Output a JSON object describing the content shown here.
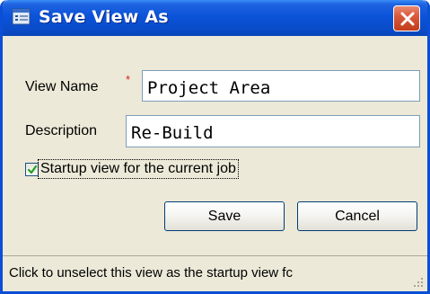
{
  "dialog": {
    "title": "Save View As",
    "close_icon": "close-icon"
  },
  "form": {
    "view_name_label": "View Name",
    "required_marker": "*",
    "view_name_value": "Project Area",
    "description_label": "Description",
    "description_value": "Re-Build",
    "startup_checked": true,
    "startup_label": "Startup view for the current job"
  },
  "buttons": {
    "save_label": "Save",
    "cancel_label": "Cancel"
  },
  "status": {
    "text": "Click to unselect this view as the startup view fc"
  },
  "colors": {
    "title_bar": "#0a4cc9",
    "close_button": "#d95a3a",
    "dialog_bg": "#ece9d8",
    "checkmark": "#21a121",
    "required": "#d02020"
  }
}
